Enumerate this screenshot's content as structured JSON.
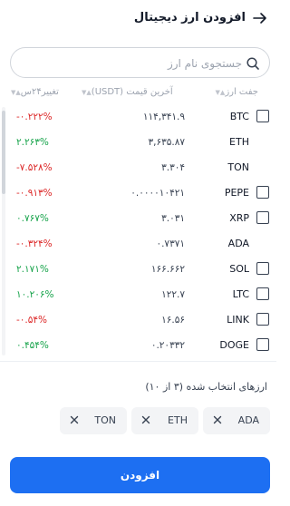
{
  "header": {
    "title": "افزودن ارز دیجیتال"
  },
  "search": {
    "placeholder": "جستجوی نام ارز"
  },
  "table": {
    "headers": {
      "pair": "جفت ارز",
      "price": "آخرین قیمت (USDT)",
      "change": "تغییر۲۴س"
    },
    "rows": [
      {
        "symbol": "BTC",
        "price": "۱۱۴,۳۴۱.۹",
        "change": "-۰.۲۲۲%",
        "trend": "neg",
        "checkbox": true
      },
      {
        "symbol": "ETH",
        "price": "۳,۶۳۵.۸۷",
        "change": "۲.۲۶۳%",
        "trend": "pos",
        "checkbox": false
      },
      {
        "symbol": "TON",
        "price": "۳.۳۰۴",
        "change": "-۷.۵۲۸%",
        "trend": "neg",
        "checkbox": false
      },
      {
        "symbol": "PEPE",
        "price": "۰.۰۰۰۰۱۰۴۲۱",
        "change": "-۰.۹۱۳%",
        "trend": "neg",
        "checkbox": true
      },
      {
        "symbol": "XRP",
        "price": "۳.۰۳۱",
        "change": "۰.۷۶۷%",
        "trend": "pos",
        "checkbox": true
      },
      {
        "symbol": "ADA",
        "price": "۰.۷۳۷۱",
        "change": "-۰.۳۲۴%",
        "trend": "neg",
        "checkbox": false
      },
      {
        "symbol": "SOL",
        "price": "۱۶۶.۶۶۲",
        "change": "۲.۱۷۱%",
        "trend": "pos",
        "checkbox": true
      },
      {
        "symbol": "LTC",
        "price": "۱۲۲.۷",
        "change": "۱۰.۲۰۶%",
        "trend": "pos",
        "checkbox": true
      },
      {
        "symbol": "LINK",
        "price": "۱۶.۵۶",
        "change": "-۰.۵۴%",
        "trend": "neg",
        "checkbox": true
      },
      {
        "symbol": "DOGE",
        "price": "۰.۲۰۳۳۲",
        "change": "۰.۴۵۴%",
        "trend": "pos",
        "checkbox": true
      }
    ]
  },
  "selected": {
    "label": "ارزهای انتخاب شده (۳ از ۱۰)",
    "chips": [
      "ADA",
      "ETH",
      "TON"
    ]
  },
  "add_button": {
    "label": "افزودن"
  },
  "colors": {
    "accent": "#1d6ff2",
    "negative": "#dc2626",
    "positive": "#16a34a"
  },
  "icons": {
    "back": "arrow-right-icon",
    "search": "search-icon",
    "remove": "close-icon"
  }
}
